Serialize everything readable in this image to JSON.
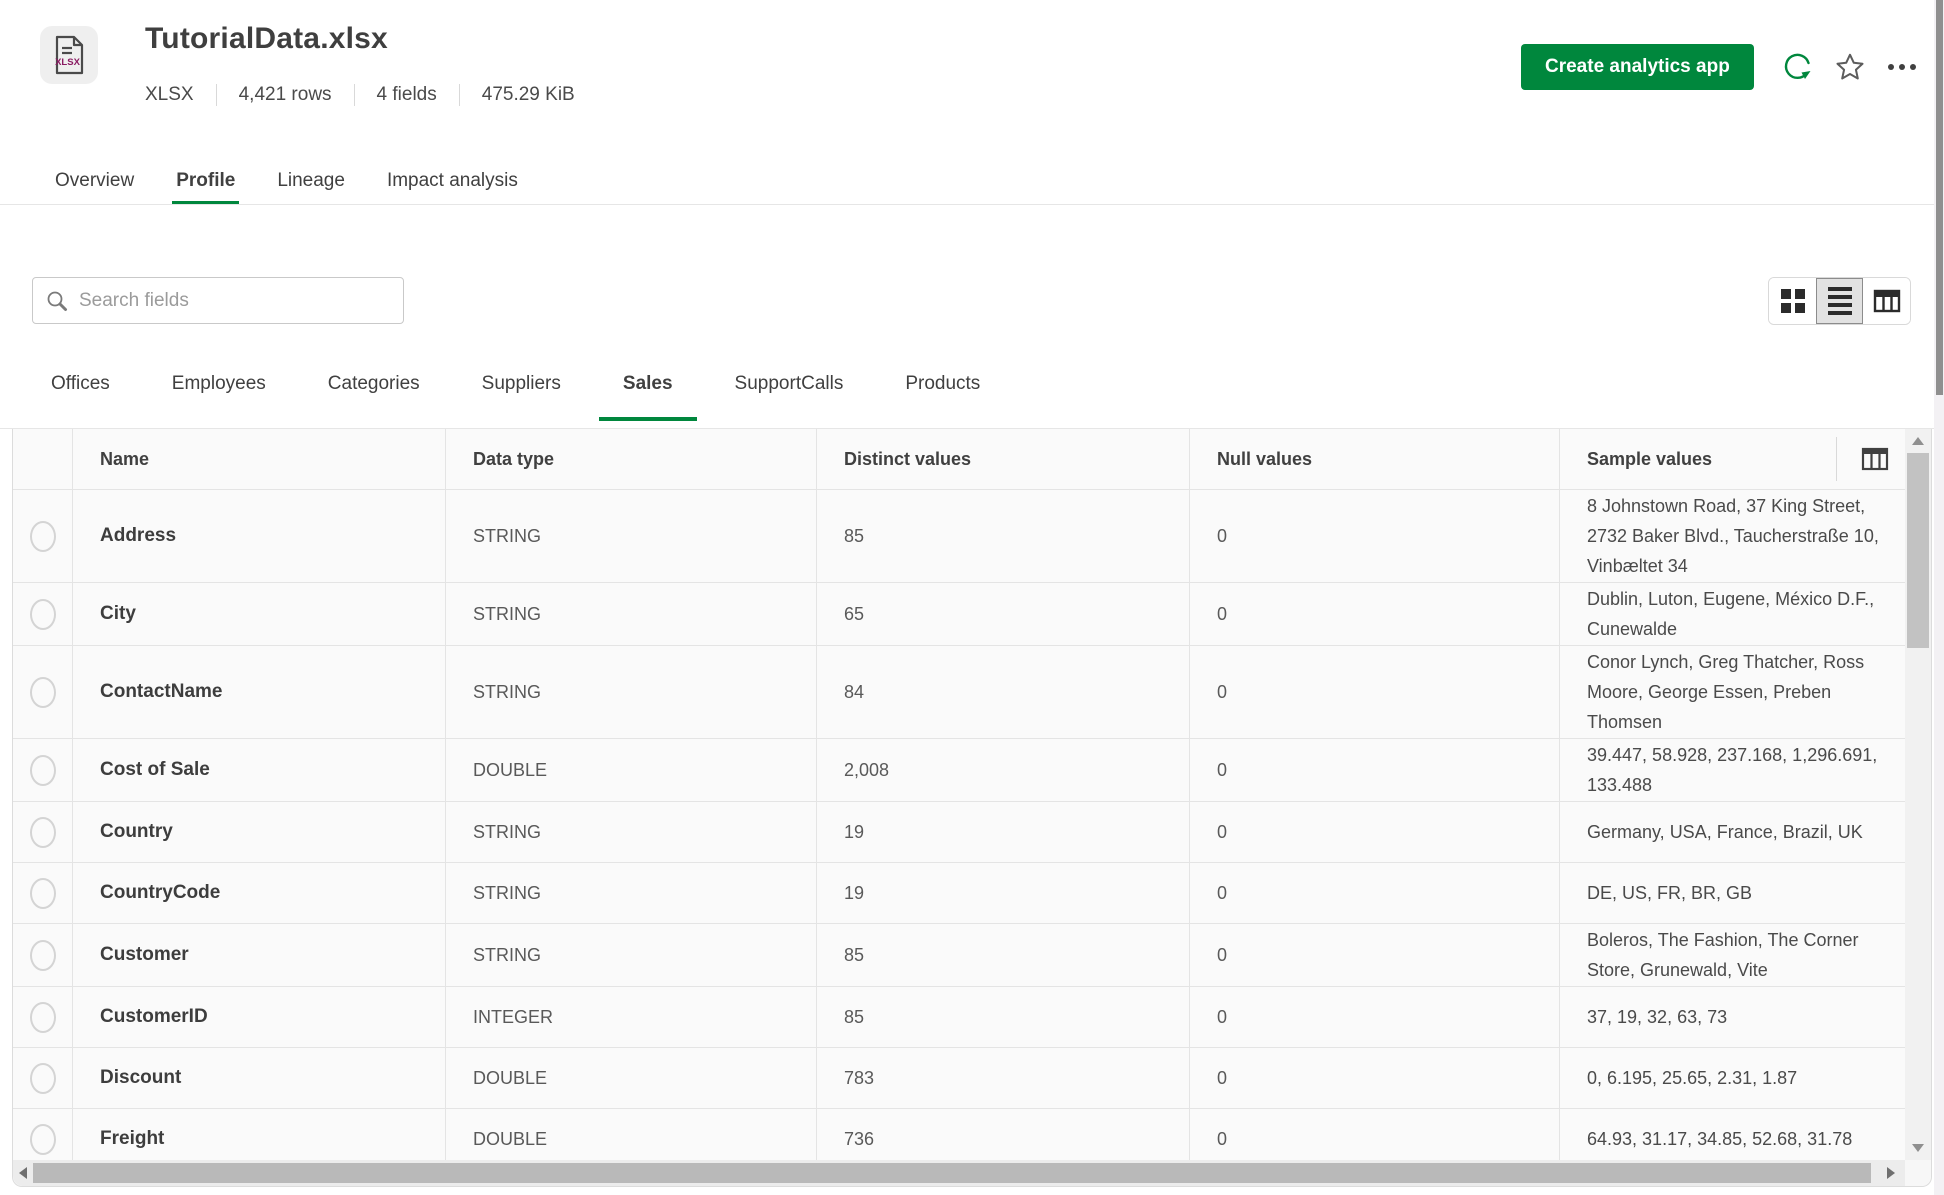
{
  "file": {
    "title": "TutorialData.xlsx",
    "icon_label": "XLSX",
    "meta": {
      "type": "XLSX",
      "rows": "4,421 rows",
      "fields": "4 fields",
      "size": "475.29 KiB"
    }
  },
  "actions": {
    "create_app": "Create analytics app"
  },
  "main_tabs": {
    "items": [
      {
        "label": "Overview",
        "active": false
      },
      {
        "label": "Profile",
        "active": true
      },
      {
        "label": "Lineage",
        "active": false
      },
      {
        "label": "Impact analysis",
        "active": false
      }
    ]
  },
  "toolbar": {
    "search_placeholder": "Search fields"
  },
  "dataset_tabs": {
    "items": [
      {
        "label": "Offices",
        "active": false
      },
      {
        "label": "Employees",
        "active": false
      },
      {
        "label": "Categories",
        "active": false
      },
      {
        "label": "Suppliers",
        "active": false
      },
      {
        "label": "Sales",
        "active": true
      },
      {
        "label": "SupportCalls",
        "active": false
      },
      {
        "label": "Products",
        "active": false
      }
    ]
  },
  "table": {
    "columns": {
      "name": "Name",
      "data_type": "Data type",
      "distinct": "Distinct values",
      "nulls": "Null values",
      "samples": "Sample values"
    },
    "rows": [
      {
        "name": "Address",
        "data_type": "STRING",
        "distinct": "85",
        "nulls": "0",
        "samples": "8 Johnstown Road, 37 King Street, 2732 Baker Blvd., Taucherstraße 10, Vinbæltet 34"
      },
      {
        "name": "City",
        "data_type": "STRING",
        "distinct": "65",
        "nulls": "0",
        "samples": "Dublin, Luton, Eugene, México D.F., Cunewalde"
      },
      {
        "name": "ContactName",
        "data_type": "STRING",
        "distinct": "84",
        "nulls": "0",
        "samples": "Conor Lynch, Greg Thatcher, Ross Moore, George Essen, Preben Thomsen"
      },
      {
        "name": "Cost of Sale",
        "data_type": "DOUBLE",
        "distinct": "2,008",
        "nulls": "0",
        "samples": "39.447, 58.928, 237.168, 1,296.691, 133.488"
      },
      {
        "name": "Country",
        "data_type": "STRING",
        "distinct": "19",
        "nulls": "0",
        "samples": "Germany, USA, France, Brazil, UK"
      },
      {
        "name": "CountryCode",
        "data_type": "STRING",
        "distinct": "19",
        "nulls": "0",
        "samples": "DE, US, FR, BR, GB"
      },
      {
        "name": "Customer",
        "data_type": "STRING",
        "distinct": "85",
        "nulls": "0",
        "samples": "Boleros, The Fashion, The Corner Store, Grunewald, Vite"
      },
      {
        "name": "CustomerID",
        "data_type": "INTEGER",
        "distinct": "85",
        "nulls": "0",
        "samples": "37, 19, 32, 63, 73"
      },
      {
        "name": "Discount",
        "data_type": "DOUBLE",
        "distinct": "783",
        "nulls": "0",
        "samples": "0, 6.195, 25.65, 2.31, 1.87"
      },
      {
        "name": "Freight",
        "data_type": "DOUBLE",
        "distinct": "736",
        "nulls": "0",
        "samples": "64.93, 31.17, 34.85, 52.68, 31.78"
      }
    ]
  },
  "colors": {
    "accent_green": "#00873D",
    "file_icon_text": "#8A1A62"
  }
}
